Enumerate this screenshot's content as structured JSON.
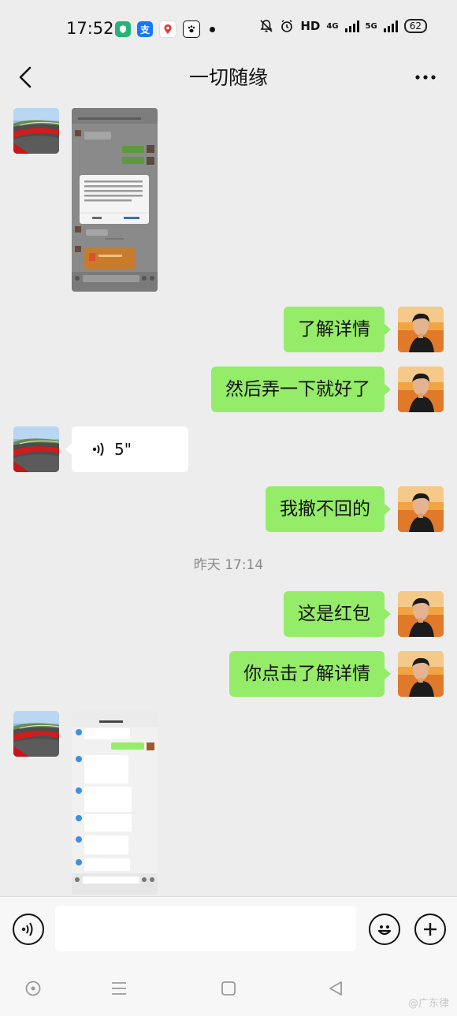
{
  "status_bar": {
    "time": "17:52",
    "network_label": "HD",
    "network_4g": "4G",
    "network_5g": "5G",
    "battery": "62",
    "icons": [
      "shield-app-icon",
      "alipay-icon",
      "map-pin-app-icon",
      "baidu-paw-icon",
      "dot-icon",
      "mute-bell-icon",
      "alarm-icon"
    ]
  },
  "nav": {
    "title": "一切随缘",
    "back_icon": "chevron-left-icon",
    "more_icon": "more-dots-icon",
    "more_text": "···"
  },
  "messages": [
    {
      "side": "left",
      "type": "image",
      "desc": "chat-screenshot-1"
    },
    {
      "side": "right",
      "type": "text",
      "text": "了解详情"
    },
    {
      "side": "right",
      "type": "text",
      "text": "然后弄一下就好了"
    },
    {
      "side": "left",
      "type": "voice",
      "duration": "5\""
    },
    {
      "side": "right",
      "type": "text",
      "text": "我撤不回的"
    },
    {
      "side": "right",
      "type": "text",
      "text": "这是红包"
    },
    {
      "side": "right",
      "type": "text",
      "text": "你点击了解详情"
    },
    {
      "side": "left",
      "type": "image",
      "desc": "chat-screenshot-2"
    }
  ],
  "timestamp": "昨天 17:14",
  "input_bar": {
    "voice_icon": "voice-mode-icon",
    "emoji_icon": "emoji-icon",
    "plus_icon": "plus-icon",
    "placeholder": ""
  },
  "system_nav": [
    "home-circle-icon",
    "menu-icon",
    "square-icon",
    "back-triangle-icon"
  ],
  "watermark": "@广东律",
  "colors": {
    "background": "#ededed",
    "green_bubble": "#95ec69",
    "white_bubble": "#ffffff",
    "timestamp": "#8a8a8a"
  }
}
